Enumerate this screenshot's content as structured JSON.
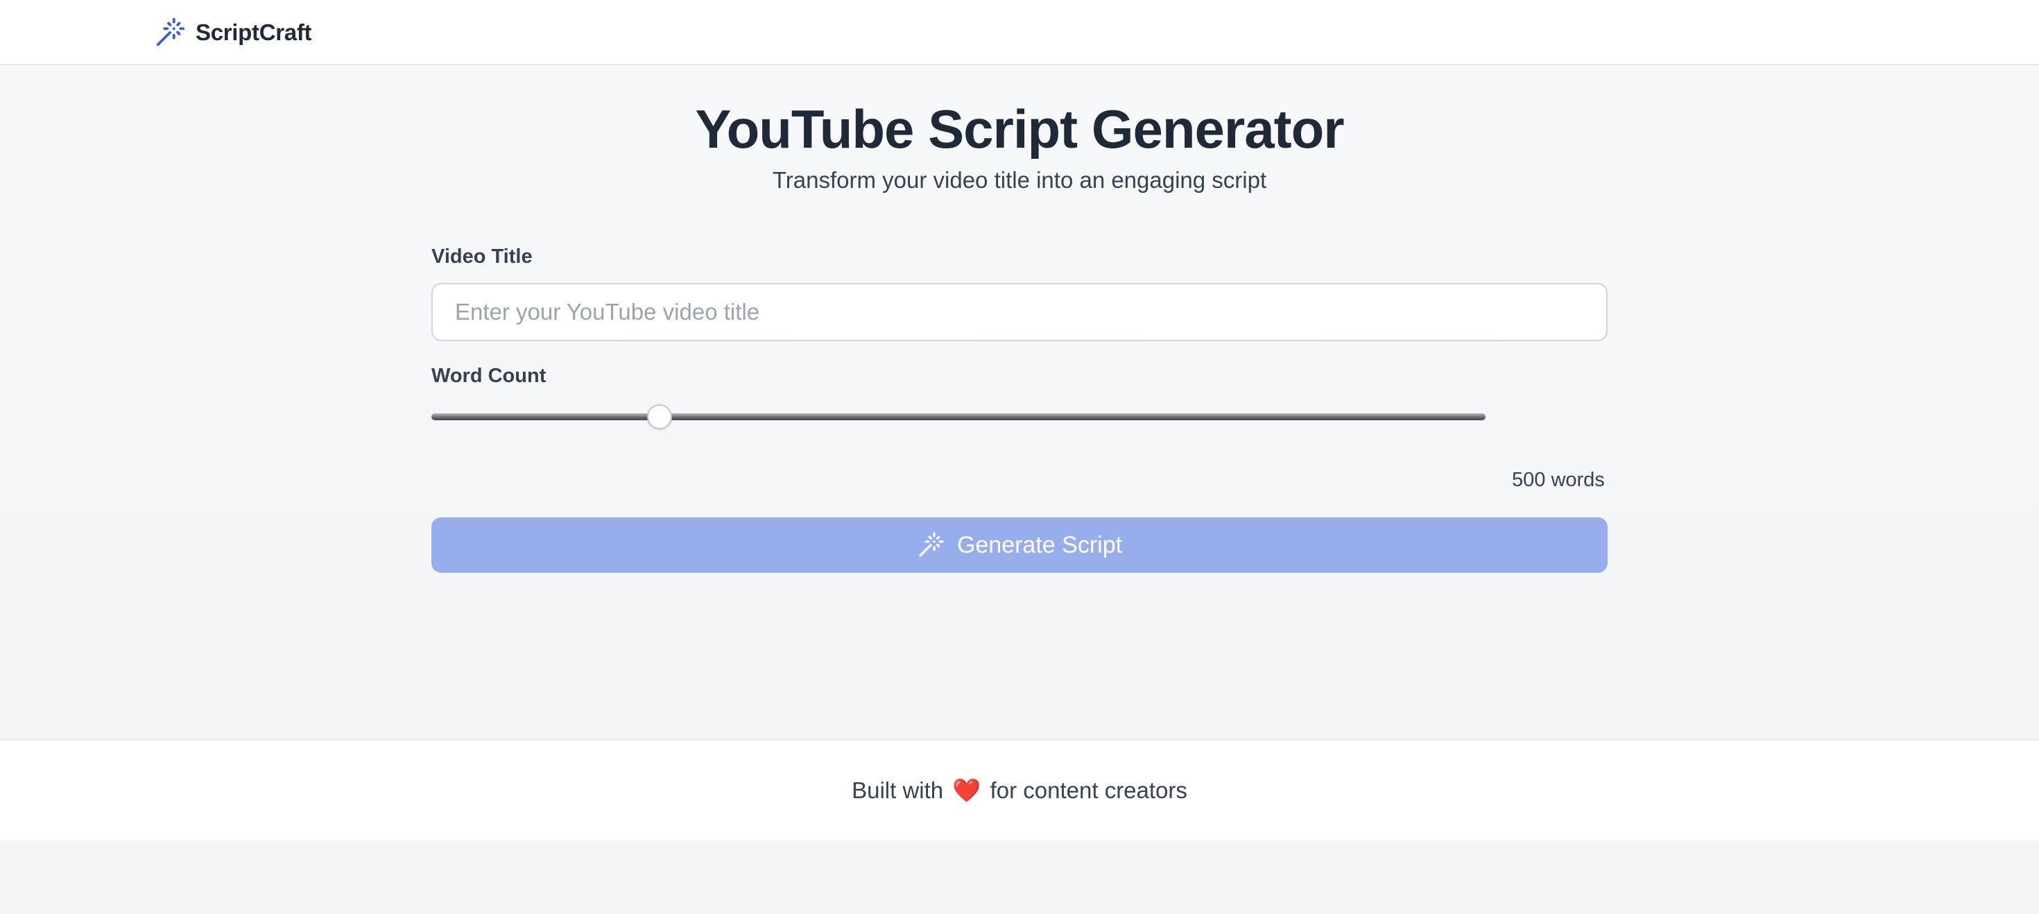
{
  "header": {
    "brand_name": "ScriptCraft",
    "brand_icon": "magic-wand-icon",
    "accent_color": "#3b5bdb"
  },
  "hero": {
    "title": "YouTube Script Generator",
    "subtitle": "Transform your video title into an engaging script"
  },
  "form": {
    "title_label": "Video Title",
    "title_placeholder": "Enter your YouTube video title",
    "title_value": "",
    "word_count_label": "Word Count",
    "word_count_fraction": 0.2167,
    "word_count_display": "500 words",
    "generate_label": "Generate Script",
    "generate_icon": "magic-wand-icon",
    "generate_color": "#98aeec"
  },
  "footer": {
    "text_before": "Built with",
    "heart": "❤️",
    "text_after": "for content creators"
  }
}
